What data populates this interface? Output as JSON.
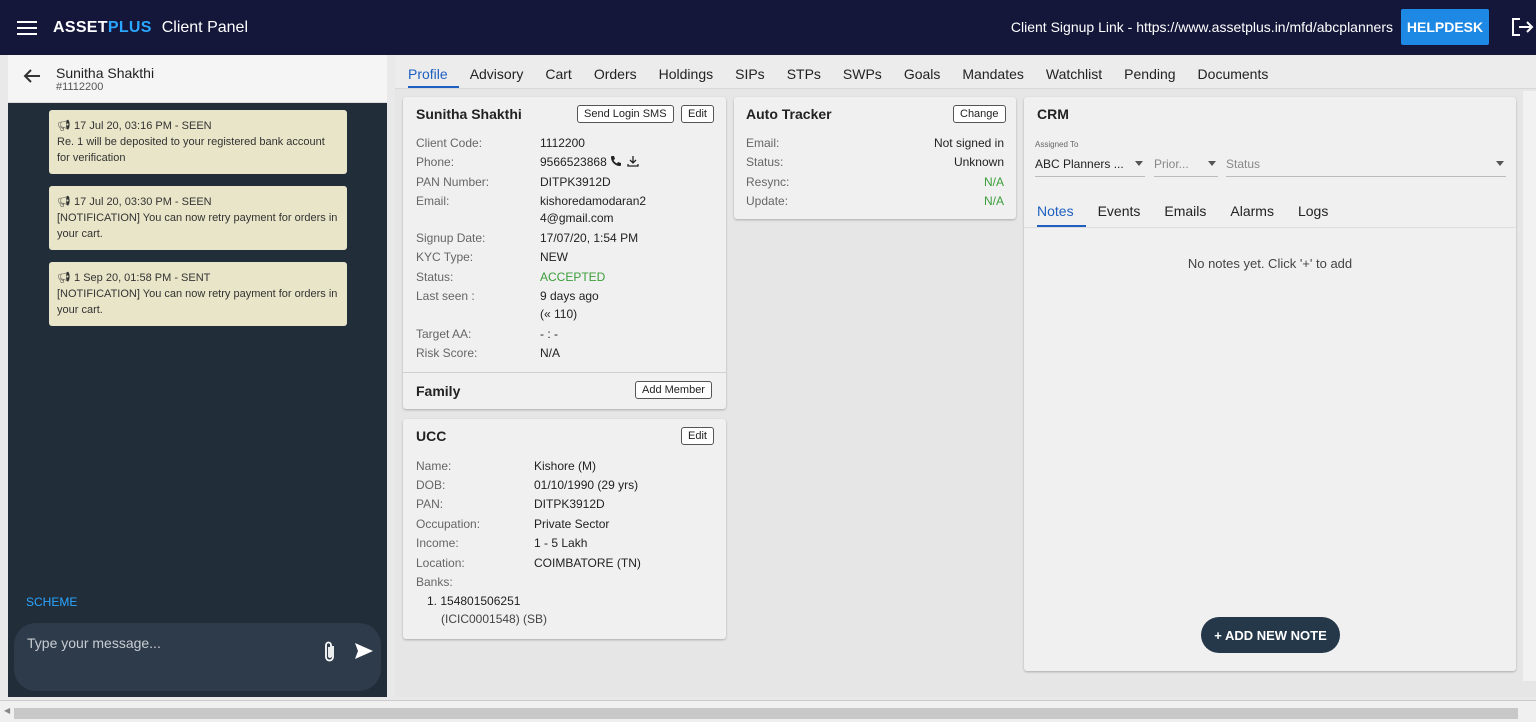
{
  "topbar": {
    "brand_a": "ASSET",
    "brand_b": "PLUS",
    "panel": "Client Panel",
    "signup": "Client Signup Link - https://www.assetplus.in/mfd/abcplanners",
    "helpdesk": "HELPDESK"
  },
  "chat": {
    "name": "Sunitha Shakthi",
    "code": "#1112200",
    "messages": [
      {
        "meta": "17 Jul 20, 03:16 PM - SEEN",
        "text": "Re. 1 will be deposited to your registered bank account for verification"
      },
      {
        "meta": "17 Jul 20, 03:30 PM - SEEN",
        "text": "[NOTIFICATION] You can now retry payment for orders in your cart."
      },
      {
        "meta": "1 Sep 20, 01:58 PM - SENT",
        "text": "[NOTIFICATION] You can now retry payment for orders in your cart."
      }
    ],
    "scheme": "SCHEME",
    "placeholder": "Type your message..."
  },
  "tabs": [
    "Profile",
    "Advisory",
    "Cart",
    "Orders",
    "Holdings",
    "SIPs",
    "STPs",
    "SWPs",
    "Goals",
    "Mandates",
    "Watchlist",
    "Pending",
    "Documents"
  ],
  "profile": {
    "name": "Sunitha Shakthi",
    "send_sms": "Send Login SMS",
    "edit": "Edit",
    "fields": [
      {
        "label": "Client Code:",
        "value": "1112200"
      },
      {
        "label": "Phone:",
        "value": "9566523868"
      },
      {
        "label": "PAN Number:",
        "value": "DITPK3912D"
      },
      {
        "label": "Email:",
        "value": "kishoredamodaran2",
        "value2": "4@gmail.com"
      },
      {
        "label": "Signup Date:",
        "value": "17/07/20, 1:54 PM"
      },
      {
        "label": "KYC Type:",
        "value": "NEW"
      },
      {
        "label": "Status:",
        "value": "ACCEPTED"
      },
      {
        "label": "Last seen :",
        "value": "9 days ago",
        "value2": "(« 110)"
      },
      {
        "label": "Target AA:",
        "value": "- : -"
      },
      {
        "label": "Risk Score:",
        "value": "N/A"
      }
    ],
    "family": "Family",
    "add_member": "Add Member"
  },
  "ucc": {
    "title": "UCC",
    "edit": "Edit",
    "fields": [
      {
        "label": "Name:",
        "value": "Kishore (M)"
      },
      {
        "label": "DOB:",
        "value": "01/10/1990 (29 yrs)"
      },
      {
        "label": "PAN:",
        "value": "DITPK3912D"
      },
      {
        "label": "Occupation:",
        "value": "Private Sector"
      },
      {
        "label": "Income:",
        "value": "1 - 5 Lakh"
      },
      {
        "label": "Location:",
        "value": "COIMBATORE (TN)"
      }
    ],
    "banks_label": "Banks:",
    "bank_line1": "1.  154801506251",
    "bank_line2": "(ICIC0001548) (SB)"
  },
  "tracker": {
    "title": "Auto Tracker",
    "change": "Change",
    "fields": [
      {
        "label": "Email:",
        "value": "Not signed in"
      },
      {
        "label": "Status:",
        "value": "Unknown"
      },
      {
        "label": "Resync:",
        "value": "N/A"
      },
      {
        "label": "Update:",
        "value": "N/A"
      }
    ]
  },
  "crm": {
    "title": "CRM",
    "assigned_to": "Assigned To",
    "assignee": "ABC Planners ...",
    "priority": "Prior...",
    "status": "Status",
    "tabs": [
      "Notes",
      "Events",
      "Emails",
      "Alarms",
      "Logs"
    ],
    "empty": "No notes yet. Click '+' to add",
    "add_note": "+ ADD NEW NOTE"
  }
}
